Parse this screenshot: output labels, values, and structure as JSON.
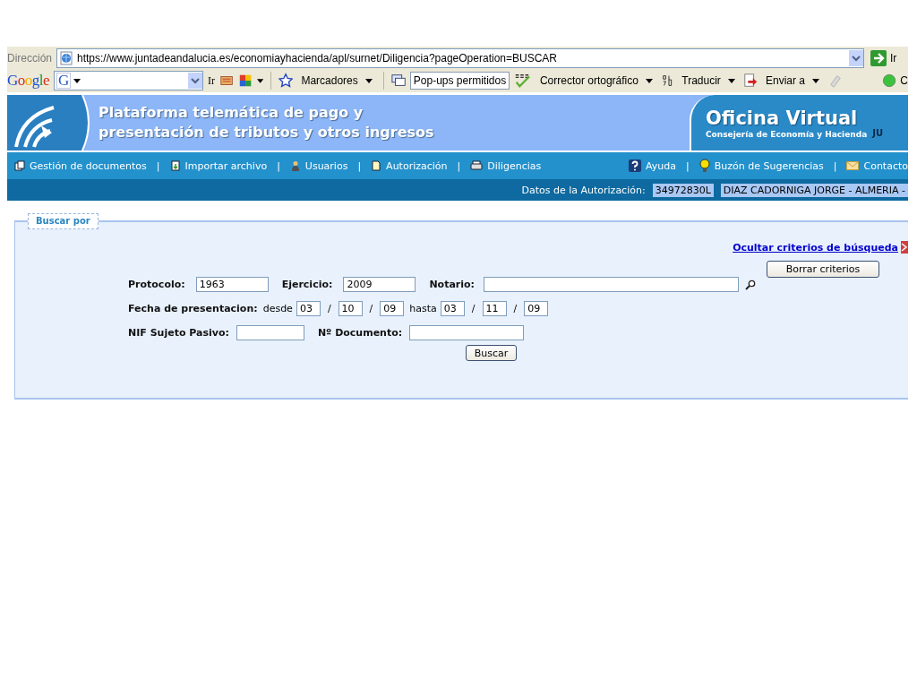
{
  "address_bar": {
    "label": "Dirección",
    "url": "https://www.juntadeandalucia.es/economiayhacienda/apl/surnet/Diligencia?pageOperation=BUSCAR",
    "go_button": "Ir"
  },
  "google_toolbar": {
    "logo": "Google",
    "field_logo": "G",
    "go_button": "Ir",
    "items": [
      {
        "label": "Marcadores",
        "dropdown": true,
        "pressed": false
      },
      {
        "label": "Pop-ups permitidos",
        "dropdown": false,
        "pressed": true
      },
      {
        "label": "Corrector ortográfico",
        "dropdown": true,
        "pressed": false
      },
      {
        "label": "Traducir",
        "dropdown": true,
        "pressed": false
      },
      {
        "label": "Enviar a",
        "dropdown": true,
        "pressed": false
      }
    ],
    "cut_item": "C"
  },
  "header": {
    "title_lines": [
      "Plataforma telemática de pago y",
      "presentación de tributos y otros ingresos"
    ],
    "brand": "Oficina Virtual",
    "subtitle": "Consejería de Economía y Hacienda",
    "cut_text": "JU"
  },
  "nav": {
    "left": [
      "Gestión de documentos",
      "Importar archivo",
      "Usuarios",
      "Autorización",
      "Diligencias"
    ],
    "right": [
      "Ayuda",
      "Buzón de Sugerencias",
      "Contacto"
    ],
    "separator": "|"
  },
  "auth_bar": {
    "label": "Datos de la Autorización:",
    "values": [
      "34972830L",
      "DIAZ CADORNIGA JORGE - ALMERIA -"
    ]
  },
  "search": {
    "legend": "Buscar por",
    "hide_link": "Ocultar criterios de búsqueda",
    "clear_button": "Borrar criterios",
    "protocolo": {
      "label": "Protocolo:",
      "value": "1963"
    },
    "ejercicio": {
      "label": "Ejercicio:",
      "value": "2009"
    },
    "notario": {
      "label": "Notario:"
    },
    "fecha": {
      "label": "Fecha de presentacion:",
      "from_label": "desde",
      "from": [
        "03",
        "10",
        "09"
      ],
      "to_label": "hasta",
      "to": [
        "03",
        "11",
        "09"
      ],
      "separator": "/"
    },
    "nif": {
      "label": "NIF Sujeto Pasivo:"
    },
    "documento": {
      "label": "Nº Documento:"
    },
    "search_button": "Buscar"
  }
}
